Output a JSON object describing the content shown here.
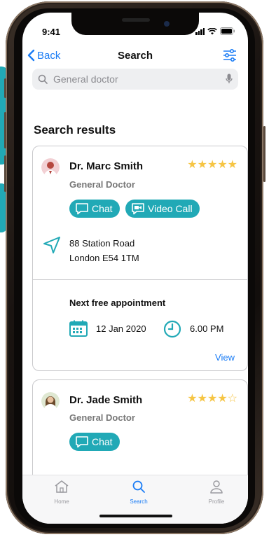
{
  "status_bar": {
    "time": "9:41"
  },
  "nav": {
    "back_label": "Back",
    "title": "Search"
  },
  "search": {
    "placeholder": "General doctor",
    "value": ""
  },
  "results": {
    "section_title": "Search results",
    "doctors": [
      {
        "name": "Dr. Marc Smith",
        "specialty": "General Doctor",
        "rating": 5,
        "rating_max": 5,
        "chat_label": "Chat",
        "video_call_label": "Video Call",
        "address_line1": "88 Station Road",
        "address_line2": "London E54 1TM",
        "next_appointment_title": "Next free appointment",
        "appointment_date": "12 Jan 2020",
        "appointment_time": "6.00 PM",
        "view_label": "View"
      },
      {
        "name": "Dr. Jade Smith",
        "specialty": "General Doctor",
        "rating": 4,
        "rating_max": 5,
        "chat_label": "Chat"
      }
    ]
  },
  "tabbar": {
    "items": [
      {
        "label": "Home",
        "icon": "home-icon",
        "active": false
      },
      {
        "label": "Search",
        "icon": "search-icon",
        "active": true
      },
      {
        "label": "Profile",
        "icon": "profile-icon",
        "active": false
      }
    ]
  },
  "colors": {
    "accent": "#21a9b6",
    "link_blue": "#1a7cf5",
    "star_gold": "#f6c544"
  }
}
